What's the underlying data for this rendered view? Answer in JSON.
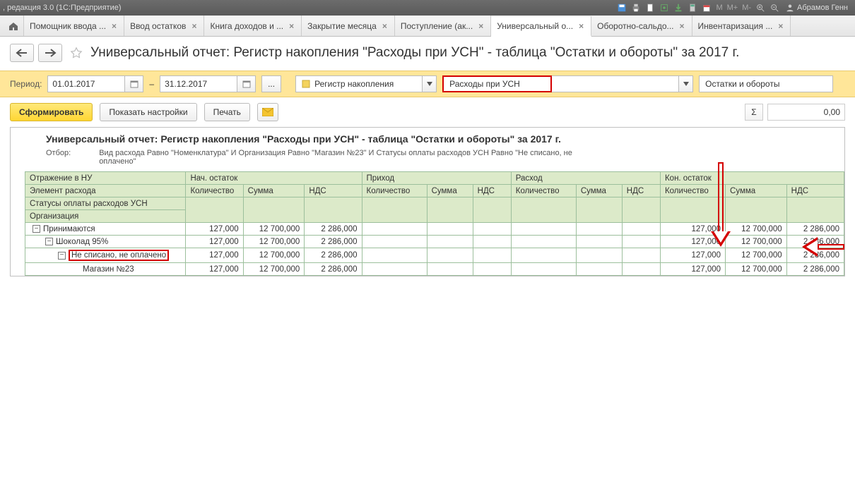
{
  "app": {
    "title": ", редакция 3.0  (1С:Предприятие)",
    "user": "Абрамов Генн",
    "m_labels": [
      "M",
      "M+",
      "M-"
    ]
  },
  "tabs": [
    {
      "label": "Помощник ввода ..."
    },
    {
      "label": "Ввод остатков"
    },
    {
      "label": "Книга доходов и ..."
    },
    {
      "label": "Закрытие месяца"
    },
    {
      "label": "Поступление (ак..."
    },
    {
      "label": "Универсальный о...",
      "active": true
    },
    {
      "label": "Оборотно-сальдо..."
    },
    {
      "label": "Инвентаризация ..."
    }
  ],
  "page_title": "Универсальный отчет: Регистр накопления \"Расходы при УСН\" - таблица \"Остатки и обороты\" за 2017 г.",
  "period": {
    "label": "Период:",
    "from": "01.01.2017",
    "dash": "–",
    "to": "31.12.2017",
    "ellipsis": "..."
  },
  "selectors": {
    "type": "Регистр накопления",
    "register": "Расходы при УСН",
    "table": "Остатки и обороты"
  },
  "actions": {
    "generate": "Сформировать",
    "settings": "Показать настройки",
    "print": "Печать"
  },
  "sum_display": "0,00",
  "report": {
    "title": "Универсальный отчет: Регистр накопления \"Расходы при УСН\" - таблица \"Остатки и обороты\" за 2017 г.",
    "filter_label": "Отбор:",
    "filter_value": "Вид расхода Равно \"Номенклатура\" И Организация Равно \"Магазин №23\" И Статусы оплаты расходов УСН Равно \"Не списано, не оплачено\"",
    "headers": {
      "col1_rows": [
        "Отражение в НУ",
        "Элемент расхода",
        "Статусы оплаты расходов УСН",
        "Организация"
      ],
      "groups": [
        "Нач. остаток",
        "Приход",
        "Расход",
        "Кон. остаток"
      ],
      "subs": [
        "Количество",
        "Сумма",
        "НДС"
      ]
    },
    "rows": [
      {
        "indent": 0,
        "label": "Принимаются",
        "nq": "127,000",
        "ns": "12 700,000",
        "nn": "2 286,000",
        "kq": "127,000",
        "ks": "12 700,000",
        "kn": "2 286,000"
      },
      {
        "indent": 1,
        "label": "Шоколад 95%",
        "nq": "127,000",
        "ns": "12 700,000",
        "nn": "2 286,000",
        "kq": "127,000",
        "ks": "12 700,000",
        "kn": "2 286,000"
      },
      {
        "indent": 2,
        "label": "Не списано, не оплачено",
        "highlight": true,
        "nq": "127,000",
        "ns": "12 700,000",
        "nn": "2 286,000",
        "kq": "127,000",
        "ks": "12 700,000",
        "kn": "2 286,000"
      },
      {
        "indent": 3,
        "label": "Магазин №23",
        "leaf": true,
        "nq": "127,000",
        "ns": "12 700,000",
        "nn": "2 286,000",
        "kq": "127,000",
        "ks": "12 700,000",
        "kn": "2 286,000"
      }
    ]
  }
}
